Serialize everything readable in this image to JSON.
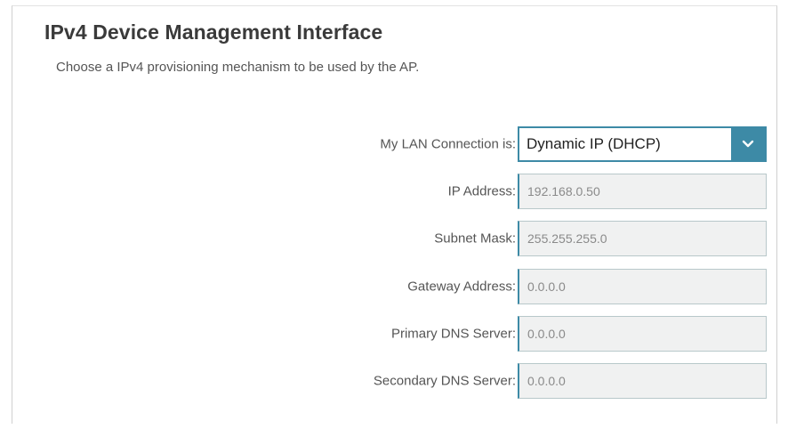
{
  "section": {
    "title": "IPv4 Device Management Interface",
    "description": "Choose a IPv4 provisioning mechanism to be used by the AP."
  },
  "form": {
    "connection": {
      "label": "My LAN Connection is:",
      "value": "Dynamic IP (DHCP)",
      "icon": "chevron-down-icon"
    },
    "ip_address": {
      "label": "IP Address:",
      "value": "192.168.0.50"
    },
    "subnet_mask": {
      "label": "Subnet Mask:",
      "value": "255.255.255.0"
    },
    "gateway": {
      "label": "Gateway Address:",
      "value": "0.0.0.0"
    },
    "primary_dns": {
      "label": "Primary DNS Server:",
      "value": "0.0.0.0"
    },
    "secondary_dns": {
      "label": "Secondary DNS Server:",
      "value": "0.0.0.0"
    }
  },
  "colors": {
    "accent": "#3d8aa6",
    "field_background": "#f0f1f1",
    "text": "#555555"
  }
}
